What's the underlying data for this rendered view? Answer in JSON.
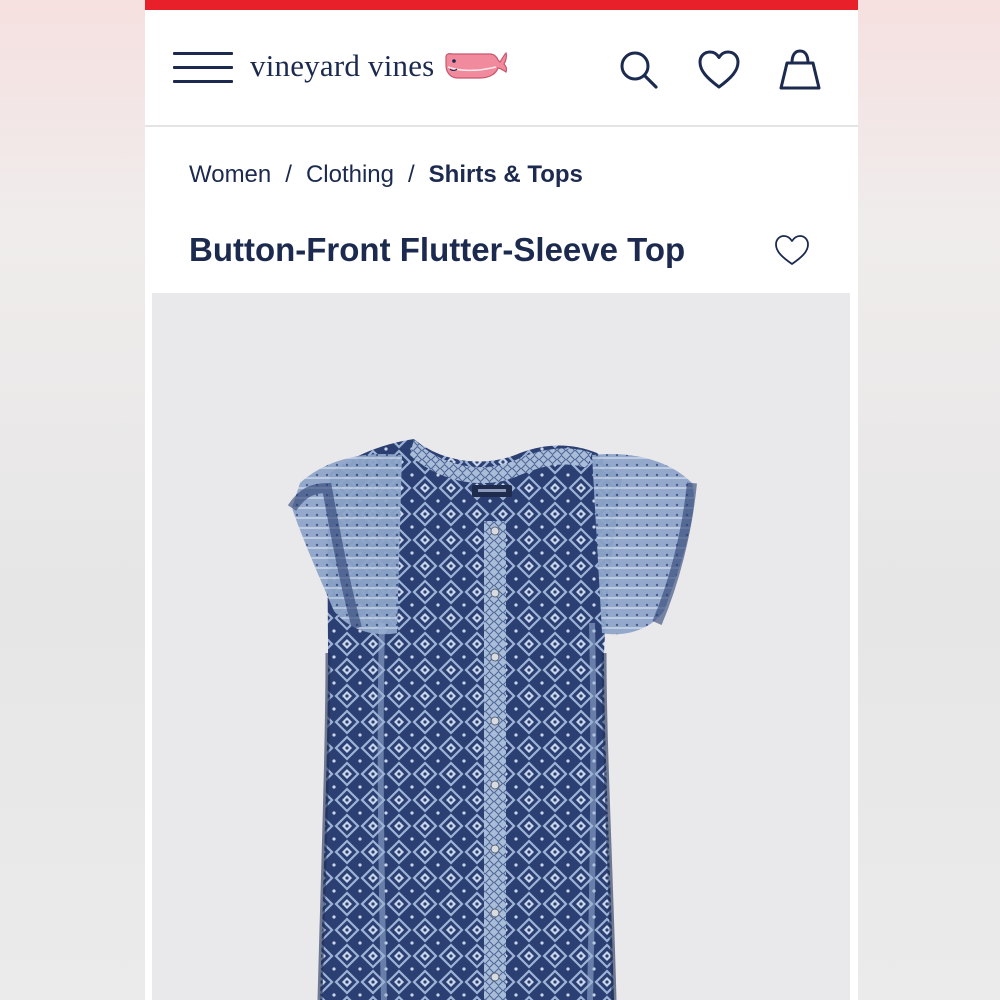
{
  "header": {
    "brand": "vineyard vines",
    "icons": {
      "menu": "hamburger-menu-icon",
      "logo": "whale-icon",
      "search": "search-icon",
      "wishlist": "heart-icon",
      "bag": "shopping-bag-icon"
    }
  },
  "breadcrumb": {
    "items": [
      "Women",
      "Clothing",
      "Shirts & Tops"
    ],
    "separator": "/"
  },
  "product": {
    "title": "Button-Front Flutter-Sleeve Top",
    "image_alt": "Button-Front Flutter-Sleeve Top in navy geometric print"
  },
  "colors": {
    "promo_bar": "#e8202a",
    "navy": "#1b2a4e",
    "whale_pink": "#f08a9c",
    "gallery_bg": "#e9e9ec"
  }
}
